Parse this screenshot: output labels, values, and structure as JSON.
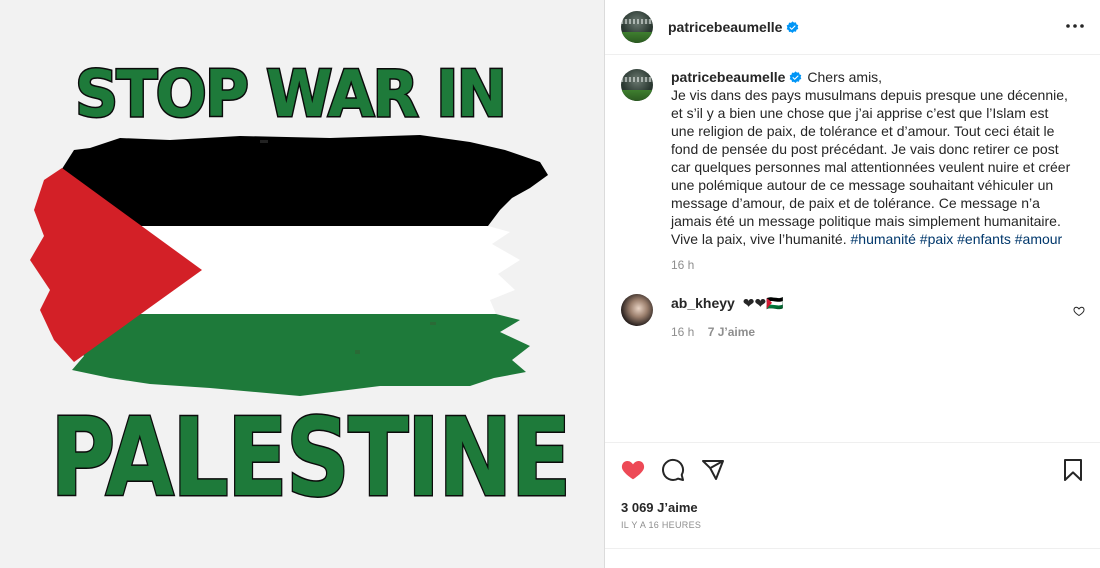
{
  "post": {
    "poster": {
      "line1": "STOP WAR IN",
      "line2": "PALESTINE"
    },
    "author": {
      "username": "patricebeaumelle",
      "verified": true
    },
    "caption": {
      "username": "patricebeaumelle",
      "text": "Chers amis,\nJe vis dans des pays musulmans depuis presque une décennie, et s’il y a bien une chose que j’ai apprise c’est que l’Islam est une religion de paix, de tolérance et d’amour. Tout ceci était le fond de pensée du post précédant. Je vais donc retirer ce post car quelques personnes mal attentionnées veulent nuire et créer une polémique autour de ce message souhaitant véhiculer un message d’amour, de paix et de tolérance. Ce message n’a jamais été un message politique mais simplement humanitaire. Vive la paix, vive l’humanité.",
      "hashtags": [
        "#humanité",
        "#paix",
        "#enfants",
        "#amour"
      ],
      "time": "16 h"
    },
    "comments": [
      {
        "username": "ab_kheyy",
        "text": "❤❤🇵🇸",
        "time": "16 h",
        "likes": "7 J’aime"
      }
    ],
    "likes_label": "3 069 J’aime",
    "posted_ago": "IL Y A 16 HEURES",
    "liked": true
  },
  "colors": {
    "hashtag": "#00376b",
    "like_red": "#ed4956",
    "verified_blue": "#0095f6",
    "flag_green": "#1e7a3a",
    "flag_red": "#d32027"
  },
  "icons": [
    "more-options-icon",
    "verified-icon",
    "heart-icon",
    "comment-icon",
    "share-icon",
    "bookmark-icon",
    "comment-like-icon"
  ]
}
